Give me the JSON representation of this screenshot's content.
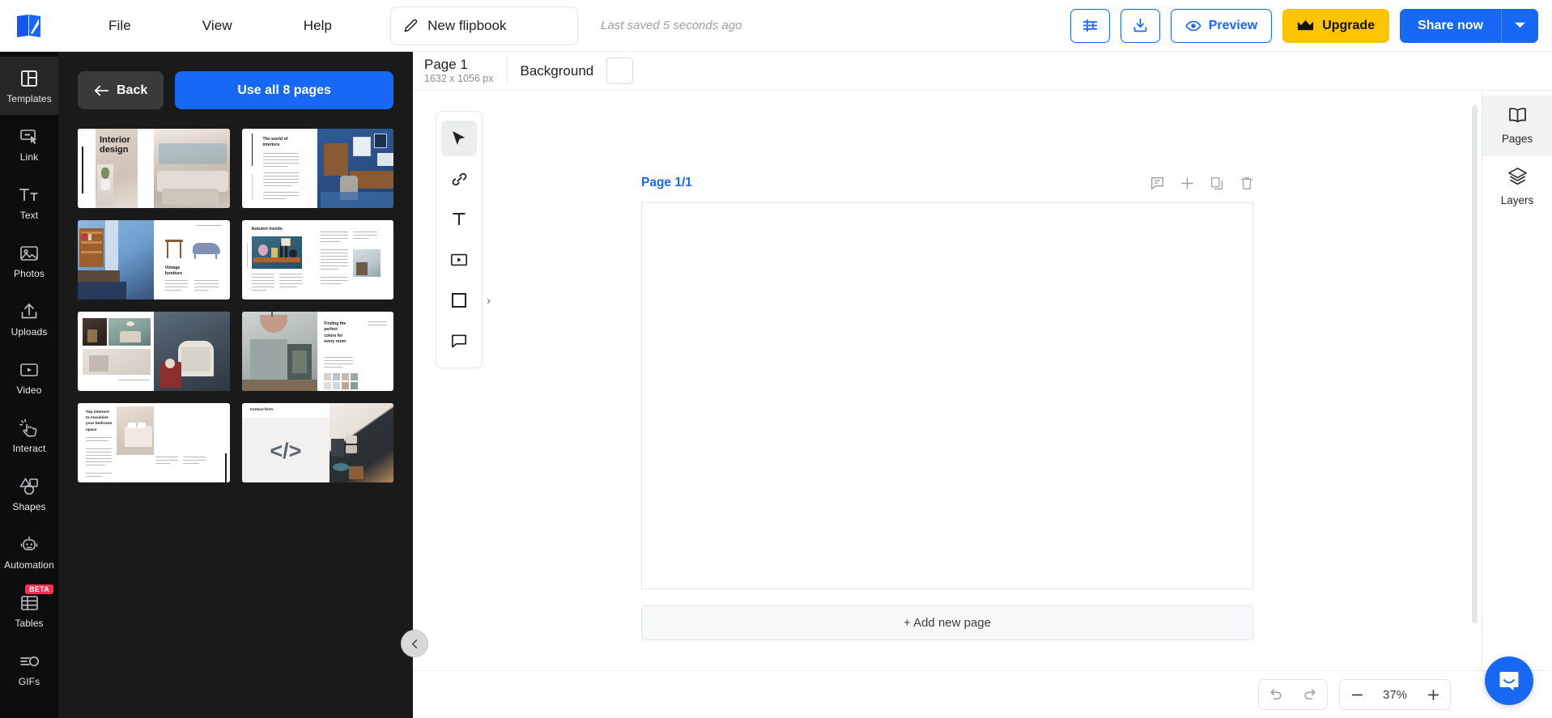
{
  "app": {
    "logo_icon": "flipbook-logo-icon"
  },
  "topbar": {
    "menu": [
      {
        "label": "File",
        "name": "menu-file"
      },
      {
        "label": "View",
        "name": "menu-view"
      },
      {
        "label": "Help",
        "name": "menu-help"
      }
    ],
    "document_title": "New flipbook",
    "title_icon": "pencil-icon",
    "last_saved": "Last saved 5 seconds ago",
    "settings_icon": "sliders-icon",
    "download_icon": "download-icon",
    "preview_label": "Preview",
    "preview_icon": "eye-icon",
    "upgrade_label": "Upgrade",
    "upgrade_icon": "crown-icon",
    "share_label": "Share now",
    "share_caret_icon": "chevron-down-icon",
    "accent_blue": "#1768f5",
    "upgrade_yellow": "#fdc500"
  },
  "sidebar": {
    "items": [
      {
        "label": "Templates",
        "icon": "templates-icon",
        "active": true
      },
      {
        "label": "Link",
        "icon": "link-box-icon",
        "active": false
      },
      {
        "label": "Text",
        "icon": "text-icon",
        "active": false
      },
      {
        "label": "Photos",
        "icon": "photos-icon",
        "active": false
      },
      {
        "label": "Uploads",
        "icon": "upload-icon",
        "active": false
      },
      {
        "label": "Video",
        "icon": "video-icon",
        "active": false
      },
      {
        "label": "Interact",
        "icon": "tap-hand-icon",
        "active": false
      },
      {
        "label": "Shapes",
        "icon": "shapes-icon",
        "active": false
      },
      {
        "label": "Automation",
        "icon": "robot-icon",
        "active": false
      },
      {
        "label": "Tables",
        "icon": "table-icon",
        "active": false,
        "badge": "BETA"
      },
      {
        "label": "GIFs",
        "icon": "gif-icon",
        "active": false
      }
    ]
  },
  "template_panel": {
    "back_label": "Back",
    "back_icon": "arrow-left-icon",
    "use_all_label": "Use all 8 pages",
    "collapse_icon": "chevron-left-icon",
    "templates": [
      {
        "title": "Interior design",
        "kind": "cover"
      },
      {
        "title": "The world of interiors",
        "kind": "article-right-photo"
      },
      {
        "title": "Vintage furniture",
        "kind": "photo-left-objects"
      },
      {
        "title": "Autumn trends",
        "kind": "three-column-article"
      },
      {
        "title": "",
        "kind": "photo-grid-texture"
      },
      {
        "title": "Finding the perfect colors for every room",
        "kind": "photo-left-title-right"
      },
      {
        "title": "Top interiors to maximise your bedroom space",
        "kind": "bedroom-article"
      },
      {
        "title": "Contact form",
        "kind": "embed-code"
      }
    ]
  },
  "page_bar": {
    "page_name": "Page 1",
    "page_dimensions": "1632 x 1056 px",
    "background_label": "Background",
    "background_color": "#ffffff"
  },
  "tools": [
    {
      "name": "select-tool",
      "icon": "cursor-arrow-icon",
      "active": true
    },
    {
      "name": "link-tool",
      "icon": "link-icon",
      "active": false
    },
    {
      "name": "text-tool",
      "icon": "text-t-icon",
      "active": false
    },
    {
      "name": "video-tool",
      "icon": "video-play-icon",
      "active": false
    },
    {
      "name": "shape-tool",
      "icon": "square-icon",
      "active": false,
      "expandable": true
    },
    {
      "name": "comment-tool",
      "icon": "speech-bubble-icon",
      "active": false
    }
  ],
  "stage": {
    "page_label": "Page 1/1",
    "page_icons": [
      {
        "name": "page-note-icon",
        "icon": "note-icon"
      },
      {
        "name": "page-add-icon",
        "icon": "plus-icon"
      },
      {
        "name": "page-duplicate-icon",
        "icon": "duplicate-icon"
      },
      {
        "name": "page-delete-icon",
        "icon": "trash-icon"
      }
    ],
    "add_page_label": "+ Add new page"
  },
  "right_rail": {
    "items": [
      {
        "label": "Pages",
        "icon": "book-open-icon",
        "active": true
      },
      {
        "label": "Layers",
        "icon": "layers-icon",
        "active": false
      }
    ]
  },
  "bottom_bar": {
    "undo_icon": "undo-icon",
    "redo_icon": "redo-icon",
    "zoom_out_icon": "minus-icon",
    "zoom_in_icon": "plus-icon",
    "zoom_level": "37%"
  },
  "chat": {
    "icon": "intercom-chat-icon"
  }
}
